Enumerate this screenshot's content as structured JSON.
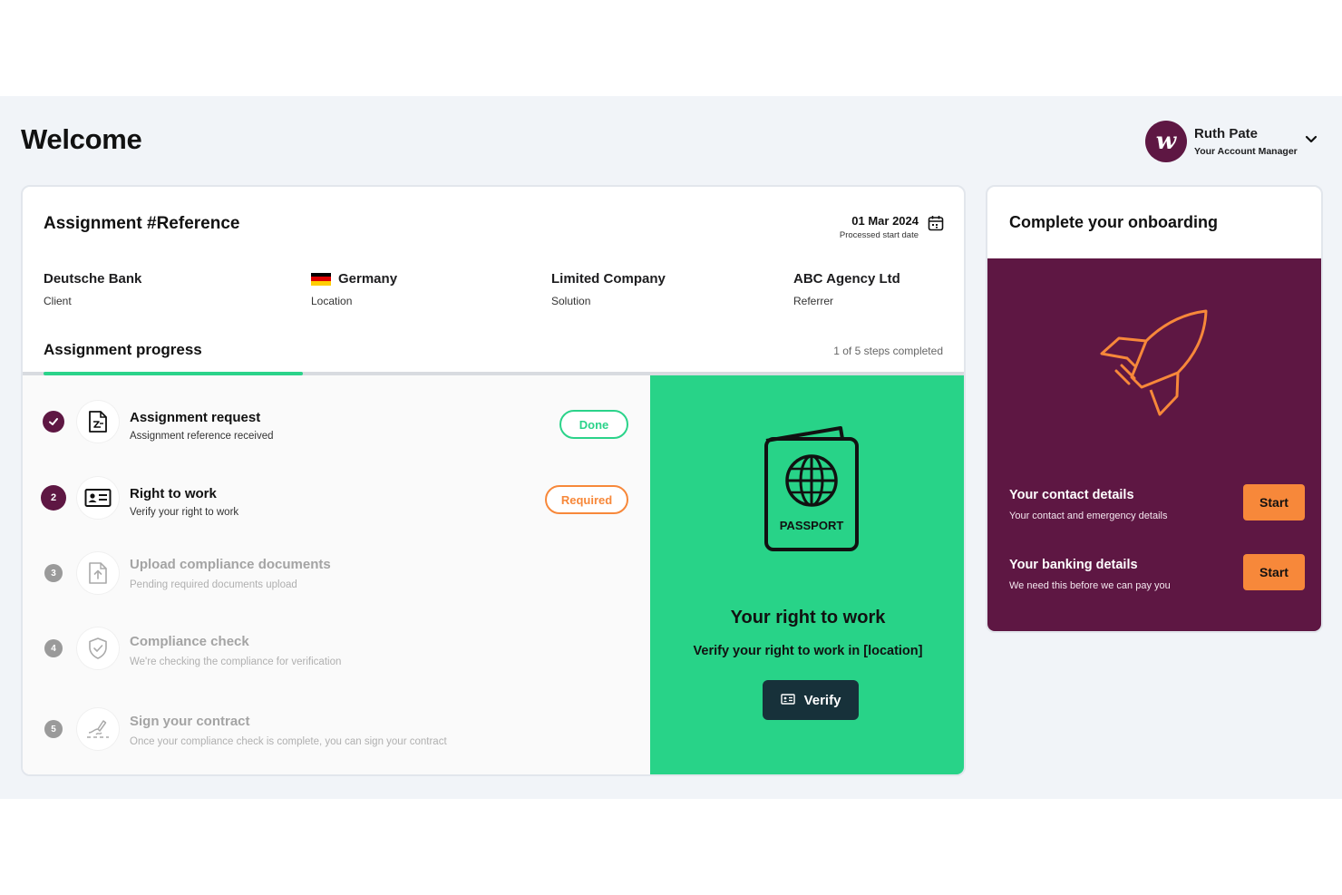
{
  "page": {
    "title": "Welcome"
  },
  "account": {
    "initial": "w",
    "name": "Ruth Pate",
    "role": "Your Account Manager",
    "icon": "chevron-down-icon"
  },
  "assignment": {
    "title": "Assignment #Reference",
    "start_date": {
      "value": "01 Mar 2024",
      "label": "Processed start date",
      "icon": "calendar-icon"
    },
    "meta": [
      {
        "value": "Deutsche Bank",
        "label": "Client"
      },
      {
        "value": "Germany",
        "label": "Location",
        "flag": [
          "#000000",
          "#dd0000",
          "#ffce00"
        ]
      },
      {
        "value": "Limited Company",
        "label": "Solution"
      },
      {
        "value": "ABC Agency Ltd",
        "label": "Referrer"
      }
    ],
    "progress": {
      "title": "Assignment progress",
      "count_text": "1 of 5 steps completed",
      "completed": 1,
      "total": 5
    },
    "steps": [
      {
        "number": "1",
        "status": "done",
        "icon": "document-signed-icon",
        "title": "Assignment request",
        "subtitle": "Assignment reference received",
        "action": "Done"
      },
      {
        "number": "2",
        "status": "current",
        "icon": "id-card-icon",
        "title": "Right to work",
        "subtitle": "Verify your right to work",
        "action": "Required"
      },
      {
        "number": "3",
        "status": "pending",
        "icon": "upload-file-icon",
        "title": "Upload compliance documents",
        "subtitle": "Pending required documents upload"
      },
      {
        "number": "4",
        "status": "pending",
        "icon": "shield-check-icon",
        "title": "Compliance check",
        "subtitle": "We're checking the compliance for verification"
      },
      {
        "number": "5",
        "status": "pending",
        "icon": "signature-icon",
        "title": "Sign your contract",
        "subtitle": "Once your compliance check is complete, you can sign your contract"
      }
    ]
  },
  "right_to_work": {
    "passport_text": "PASSPORT",
    "title": "Your right to work",
    "subtitle": "Verify your right to work in [location]",
    "button_label": "Verify",
    "icon": "id-card-icon"
  },
  "onboarding": {
    "title": "Complete your onboarding",
    "icon": "rocket-icon",
    "items": [
      {
        "title": "Your contact details",
        "subtitle": "Your contact and emergency details",
        "button": "Start"
      },
      {
        "title": "Your banking details",
        "subtitle": "We need this before we can pay you",
        "button": "Start"
      }
    ]
  },
  "colors": {
    "brand": "#5e1743",
    "accent_green": "#2bd38a",
    "accent_orange": "#f7883a",
    "dark_button": "#17313a"
  }
}
